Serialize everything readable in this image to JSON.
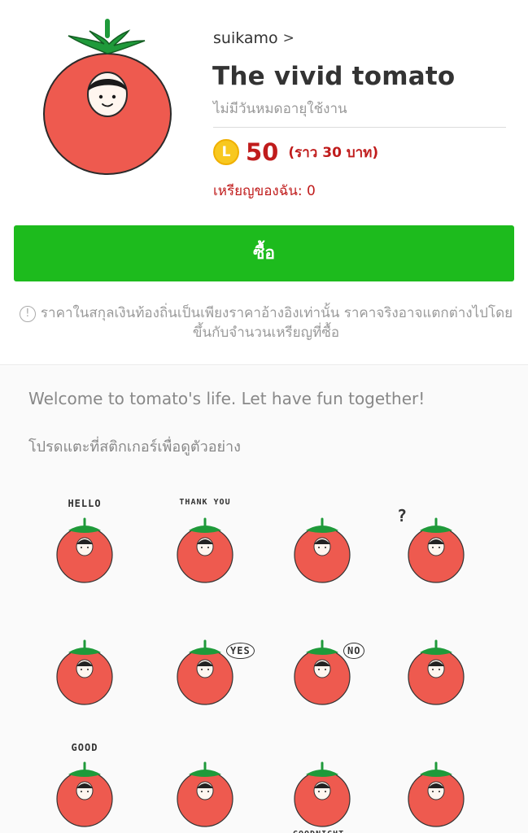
{
  "package": {
    "author": "suikamo",
    "author_chevron": ">",
    "title": "The vivid tomato",
    "validity": "ไม่มีวันหมดอายุใช้งาน",
    "coin_symbol": "L",
    "price": "50",
    "price_approx": "(ราว  30 บาท)",
    "my_coins": "เหรียญของฉัน: 0",
    "buy_label": "ซื้อ",
    "notice_icon": "!",
    "notice_text": "ราคาในสกุลเงินท้องถิ่นเป็นเพียงราคาอ้างอิงเท่านั้น ราคาจริงอาจแตกต่างไปโดยขึ้นกับจำนวนเหรียญที่ซื้อ"
  },
  "details": {
    "description": "Welcome to tomato's life. Let have fun together!",
    "tap_hint": "โปรดแตะที่สติกเกอร์เพื่อดูตัวอย่าง"
  },
  "stickers": [
    {
      "caption": "HELLO"
    },
    {
      "caption": "THANK YOU"
    },
    {
      "caption": ""
    },
    {
      "caption": "?"
    },
    {
      "caption": ""
    },
    {
      "caption": "YES"
    },
    {
      "caption": "NO"
    },
    {
      "caption": ""
    },
    {
      "caption": "GOOD"
    },
    {
      "caption": ""
    },
    {
      "caption": "GOODNIGHT"
    },
    {
      "caption": ""
    }
  ],
  "colors": {
    "tomato": "#ee5a4f",
    "leaf": "#1f9a3a",
    "price_red": "#c01c1c",
    "buy_green": "#1dbb1d",
    "coin_gold": "#f8c81f"
  }
}
